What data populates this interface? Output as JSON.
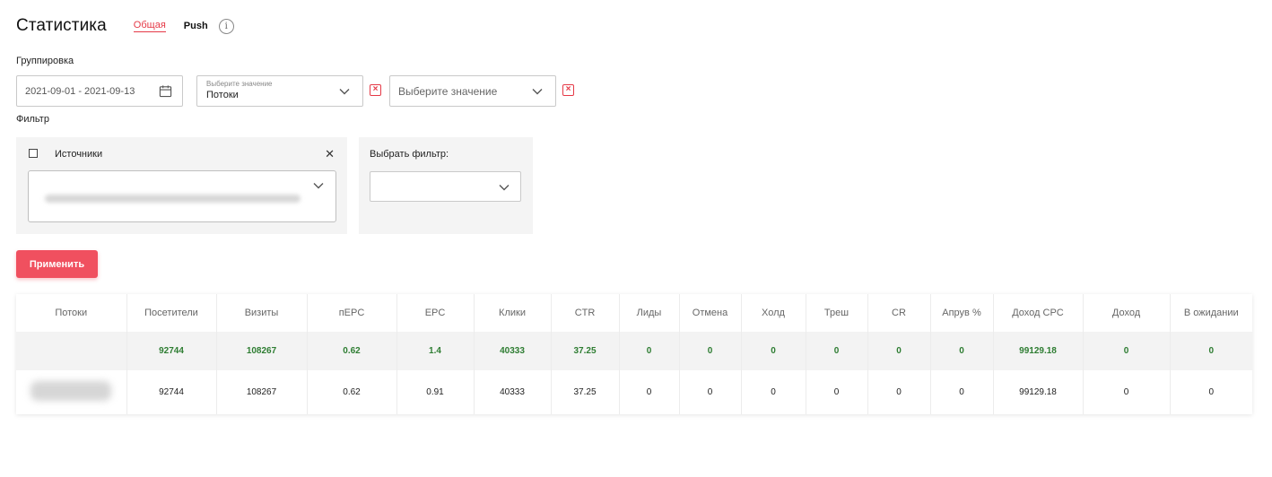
{
  "header": {
    "title": "Статистика",
    "tabs": [
      {
        "label": "Общая",
        "active": true
      },
      {
        "label": "Push",
        "active": false
      }
    ],
    "info_icon": "info-icon"
  },
  "grouping": {
    "label": "Группировка",
    "date_range": "2021-09-01 - 2021-09-13",
    "select1": {
      "placeholder": "Выберите значение",
      "value": "Потоки"
    },
    "select2": {
      "placeholder": "Выберите значение",
      "value": ""
    }
  },
  "filter": {
    "label": "Фильтр",
    "sources_label": "Источники",
    "choose_filter_label": "Выбрать фильтр:"
  },
  "apply_label": "Применить",
  "colors": {
    "accent": "#e53946",
    "button": "#f0505f",
    "total_text": "#2e7d32"
  },
  "table": {
    "columns": [
      "Потоки",
      "Посетители",
      "Визиты",
      "пEPC",
      "EPC",
      "Клики",
      "CTR",
      "Лиды",
      "Отмена",
      "Холд",
      "Треш",
      "CR",
      "Апрув %",
      "Доход CPC",
      "Доход",
      "В ожидании"
    ],
    "total_row": [
      "",
      "92744",
      "108267",
      "0.62",
      "1.4",
      "40333",
      "37.25",
      "0",
      "0",
      "0",
      "0",
      "0",
      "0",
      "99129.18",
      "0",
      "0"
    ],
    "rows": [
      [
        "",
        "92744",
        "108267",
        "0.62",
        "0.91",
        "40333",
        "37.25",
        "0",
        "0",
        "0",
        "0",
        "0",
        "0",
        "99129.18",
        "0",
        "0"
      ]
    ]
  }
}
